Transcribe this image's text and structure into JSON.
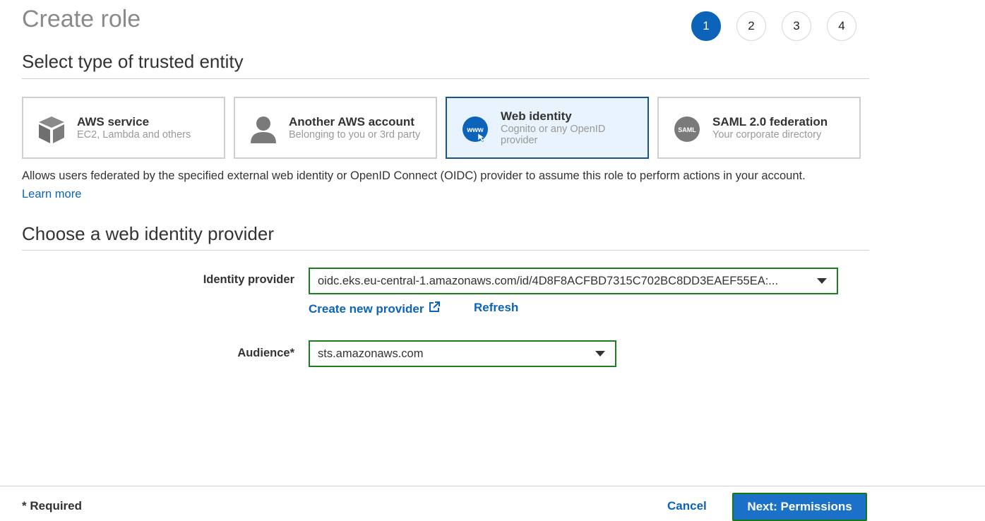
{
  "page": {
    "title": "Create role"
  },
  "steps": [
    "1",
    "2",
    "3",
    "4"
  ],
  "active_step": 1,
  "section1": {
    "heading": "Select type of trusted entity"
  },
  "entities": [
    {
      "title": "AWS service",
      "subtitle": "EC2, Lambda and others",
      "icon": "cube-icon",
      "selected": false
    },
    {
      "title": "Another AWS account",
      "subtitle": "Belonging to you or 3rd party",
      "icon": "user-icon",
      "selected": false
    },
    {
      "title": "Web identity",
      "subtitle": "Cognito or any OpenID provider",
      "icon": "www-globe-icon",
      "selected": true
    },
    {
      "title": "SAML 2.0 federation",
      "subtitle": "Your corporate directory",
      "icon": "saml-icon",
      "selected": false
    }
  ],
  "description": "Allows users federated by the specified external web identity or OpenID Connect (OIDC) provider to assume this role to perform actions in your account.",
  "learn_more": "Learn more",
  "section2": {
    "heading": "Choose a web identity provider"
  },
  "form": {
    "identity_provider_label": "Identity provider",
    "identity_provider_value": "oidc.eks.eu-central-1.amazonaws.com/id/4D8F8ACFBD7315C702BC8DD3EAEF55EA:...",
    "create_provider": "Create new provider",
    "refresh": "Refresh",
    "audience_label": "Audience*",
    "audience_value": "sts.amazonaws.com"
  },
  "footer": {
    "required": "* Required",
    "cancel": "Cancel",
    "next": "Next: Permissions"
  },
  "colors": {
    "accent": "#0b63ba",
    "selected_bg": "#e8f3fd",
    "focus_border": "#1e7d1e"
  }
}
